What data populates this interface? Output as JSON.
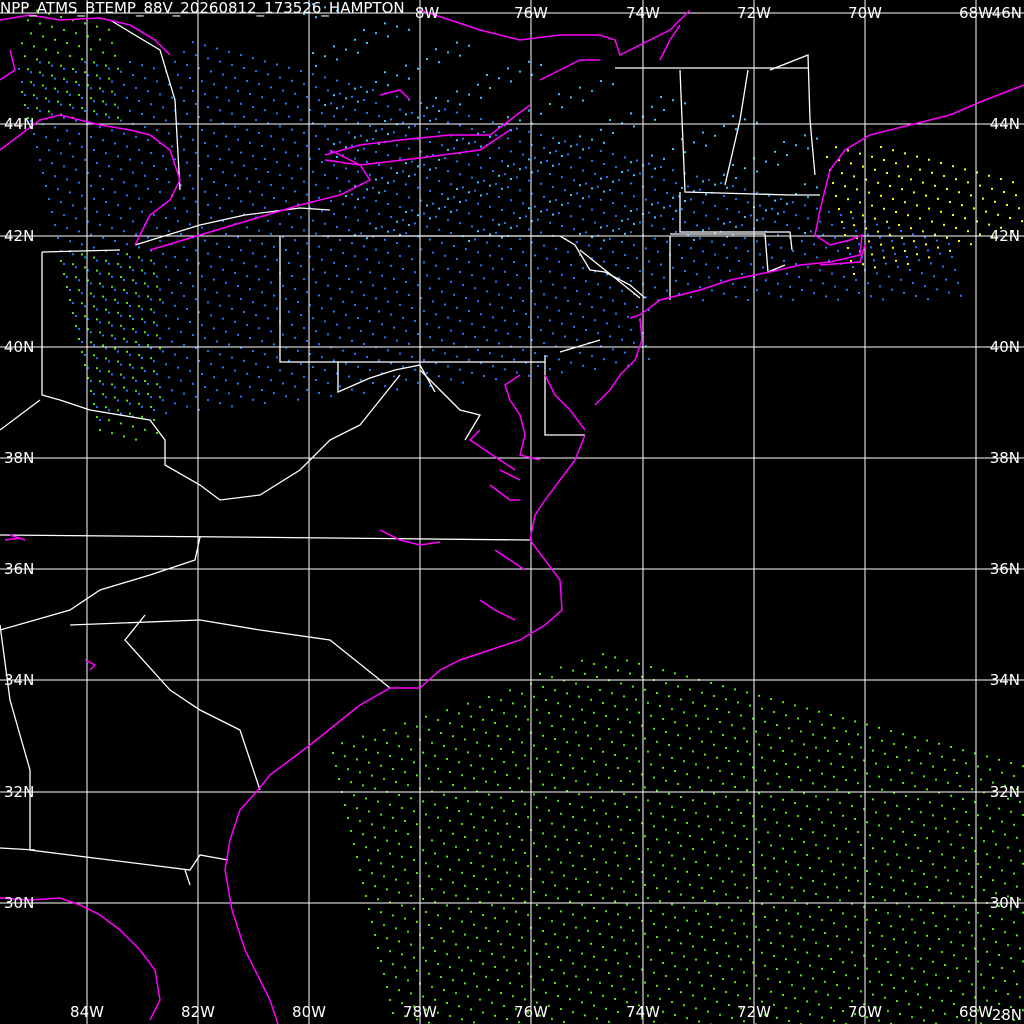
{
  "title": "NPP_ATMS_BTEMP_88V_20260812_173526_HAMPTON",
  "top_lon_labels": [
    "8W",
    "76W",
    "74W",
    "72W",
    "70W",
    "68W"
  ],
  "top_lat_label": "46N",
  "bottom_lon_labels": [
    "84W",
    "82W",
    "80W",
    "78W",
    "76W",
    "74W",
    "72W",
    "70W",
    "68W"
  ],
  "bottom_lat_label": "28N",
  "lat_labels": [
    "44N",
    "42N",
    "40N",
    "38N",
    "36N",
    "34N",
    "32N",
    "30N"
  ],
  "colors": {
    "background": "#000000",
    "graticule": "#ffffff",
    "coastline": "#ff00ff",
    "state_borders": "#ffffff",
    "scan_cold": "#1e78ff",
    "scan_cool": "#32c8ff",
    "scan_mild": "#50e600",
    "scan_warm": "#ffff00"
  }
}
